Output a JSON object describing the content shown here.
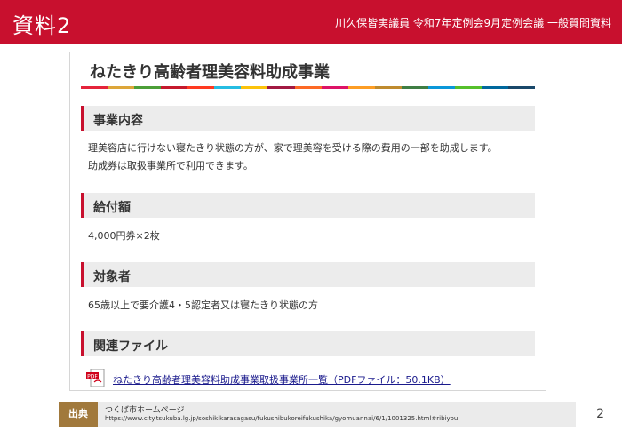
{
  "header": {
    "label": "資料2",
    "meta": "川久保皆実議員 令和7年定例会9月定例会議 一般質問資料"
  },
  "card": {
    "title": "ねたきり高齢者理美容料助成事業",
    "rainbow_colors": [
      "#e5243b",
      "#dda63a",
      "#4c9f38",
      "#c5192d",
      "#ff3a21",
      "#26bde2",
      "#fcc30b",
      "#a21942",
      "#fd6925",
      "#dd1367",
      "#fd9d24",
      "#bf8b2e",
      "#3f7e44",
      "#0a97d9",
      "#56c02b",
      "#00689d",
      "#19486a"
    ],
    "sections": [
      {
        "heading": "事業内容",
        "lines": [
          "理美容店に行けない寝たきり状態の方が、家で理美容を受ける際の費用の一部を助成します。",
          "助成券は取扱事業所で利用できます。"
        ]
      },
      {
        "heading": "給付額",
        "lines": [
          "4,000円券×2枚"
        ]
      },
      {
        "heading": "対象者",
        "lines": [
          "65歳以上で要介護4・5認定者又は寝たきり状態の方"
        ]
      },
      {
        "heading": "関連ファイル",
        "lines": []
      }
    ],
    "file_link": "ねたきり高齢者理美容料助成事業取扱事業所一覧（PDFファイル：50.1KB）",
    "pdf_icon_text": "PDF"
  },
  "source": {
    "label": "出典",
    "name": "つくば市ホームページ",
    "url": "https://www.city.tsukuba.lg.jp/soshikikarasagasu/fukushibukoreifukushika/gyomuannai/6/1/1001325.html#ribiyou"
  },
  "page_number": "2"
}
